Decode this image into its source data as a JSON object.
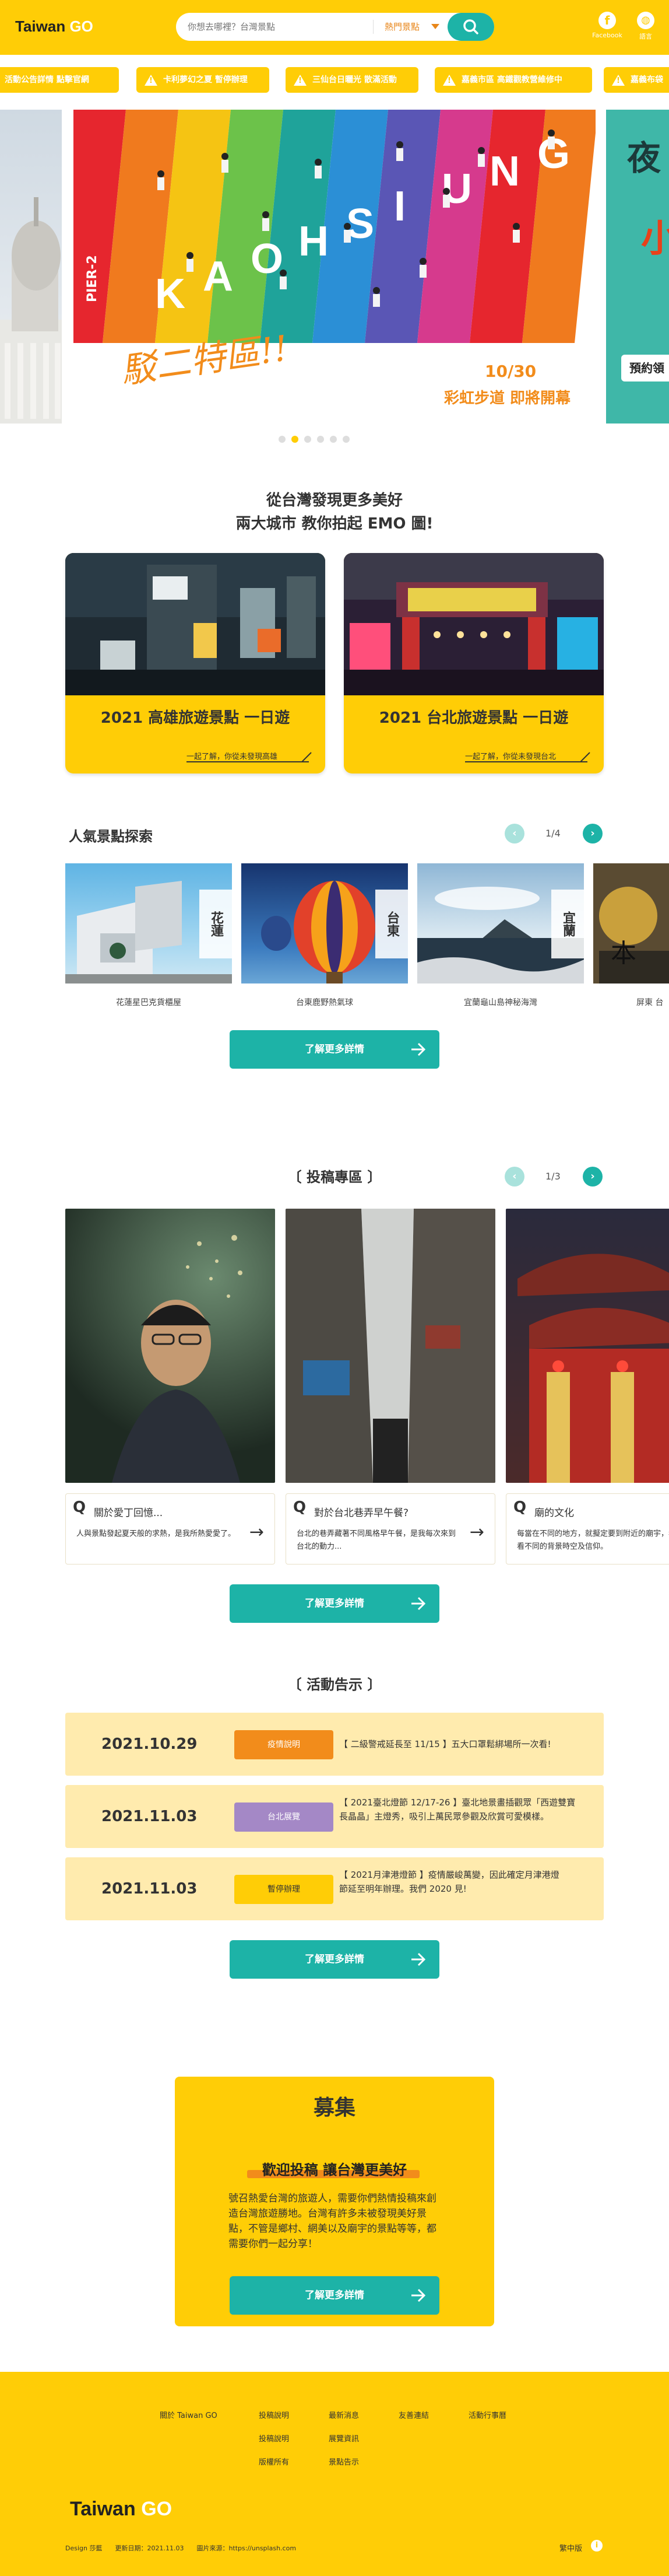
{
  "header": {
    "logo_a": "Taiwan",
    "logo_b": "GO",
    "search_placeholder": "你想去哪裡？台灣景點",
    "hot_label": "熱門景點",
    "fb_label": "Facebook",
    "lang_label": "語言"
  },
  "ticker": [
    "活動公告詳情 點擊官網",
    "卡利夢幻之夏 暫停辦理",
    "三仙台日曬光 散滿活動",
    "嘉義市區 高鐵觀教營維修中",
    "嘉義布袋"
  ],
  "carousel": {
    "main_letters": [
      "K",
      "A",
      "O",
      "H",
      "S",
      "I",
      "U",
      "N",
      "G"
    ],
    "pier": "PIER-2",
    "handwriting": "駁二特區!!",
    "date": "10/30",
    "caption": "彩虹步道 即將開幕",
    "right_title": "夜",
    "right_sub": "小",
    "right_tag": "預約領",
    "dot_count": 6,
    "active_dot": 1
  },
  "intro": {
    "line1": "從台灣發現更多美好",
    "line2": "兩大城市 教你拍起 EMO 圖!"
  },
  "city_cards": [
    {
      "title": "2021 高雄旅遊景點 一日遊",
      "sub": "一起了解，你從未發現高雄"
    },
    {
      "title": "2021 台北旅遊景點 一日遊",
      "sub": "一起了解，你從未發現台北"
    }
  ],
  "spots": {
    "title": "人氣景點探索",
    "pager": "1/4",
    "items": [
      {
        "tag": "花蓮",
        "caption": "花蓮星巴克貨櫃屋"
      },
      {
        "tag": "台東",
        "caption": "台東鹿野熱氣球"
      },
      {
        "tag": "宜蘭",
        "caption": "宜蘭龜山島神秘海灣"
      },
      {
        "tag": "屏東",
        "caption": "屏東 台"
      }
    ],
    "more": "了解更多詳情"
  },
  "submissions": {
    "title": "〔 投稿專區 〕",
    "pager": "1/3",
    "items": [
      {
        "q": "Q",
        "title": "關於愛丁回憶...",
        "desc": "人與景點發起夏天般的求熱，是我所熱愛愛了。"
      },
      {
        "q": "Q",
        "title": "對於台北巷弄早午餐?",
        "desc": "台北的巷弄藏著不同風格早午餐，是我每次來到台北的動力..."
      },
      {
        "q": "Q",
        "title": "廟的文化",
        "desc": "每當在不同的地方，就擬定要到附近的廟宇，看看不同的背景時空及信仰。"
      }
    ],
    "more": "了解更多詳情"
  },
  "events": {
    "title": "〔 活動告示 〕",
    "items": [
      {
        "date": "2021.10.29",
        "badge": "疫情說明",
        "badge_color": "#F28C1B",
        "text": "【 二級警戒延長至 11/15 】五大口罩鬆綁場所一次看!"
      },
      {
        "date": "2021.11.03",
        "badge": "台北展覽",
        "badge_color": "#A488C6",
        "text": "【 2021臺北燈節 12/17-26 】臺北地景畫插觀眾「西遊雙寶長晶晶」主燈秀，吸引上萬民眾參觀及欣賞可愛模樣。"
      },
      {
        "date": "2021.11.03",
        "badge": "暫停辦理",
        "badge_color": "#FFCD06",
        "text": "【 2021月津港燈節 】疫情嚴峻萬變，因此確定月津港燈節延至明年辦理。我們 2020 見!"
      }
    ],
    "more": "了解更多詳情"
  },
  "recruit": {
    "title": "募集",
    "headline": "歡迎投稿 讓台灣更美好",
    "body": "號召熱愛台灣的旅遊人，需要你們熱情投稿來創造台灣旅遊勝地。台灣有許多未被發現美好景點，不管是鄉村、網美以及廟宇的景點等等，都需要你們一起分享！",
    "button": "了解更多詳情"
  },
  "footer": {
    "links_row1": [
      "關於 Taiwan GO",
      "投稿說明",
      "最新消息",
      "友善連結",
      "活動行事曆"
    ],
    "links_row2": [
      "投稿說明",
      "展覽資訊"
    ],
    "links_row3": [
      "版權所有",
      "景點告示"
    ],
    "logo_a": "Taiwan",
    "logo_b": "GO",
    "credit": "Design 莎藍　　更新日期：2021.11.03　　圖片來源：https://unsplash.com",
    "lang": "繁中版"
  },
  "colors": {
    "brand": "#FFCD06",
    "teal": "#1DB3A7",
    "orange": "#F28C1B"
  }
}
